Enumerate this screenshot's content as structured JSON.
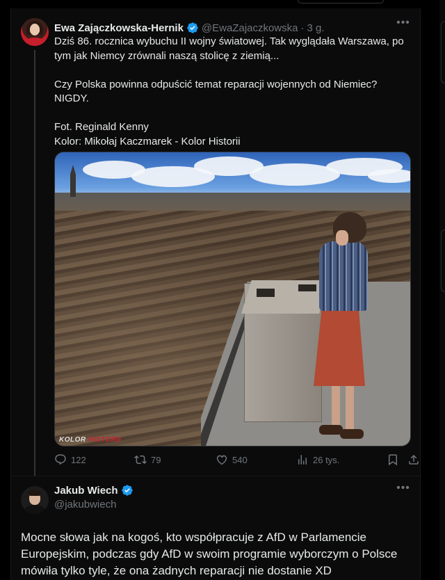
{
  "tweet1": {
    "author_name": "Ewa Zajączkowska-Hernik",
    "author_handle": "@EwaZajaczkowska",
    "separator": "·",
    "time": "3 g.",
    "lines": [
      "Dziś 86. rocznica wybuchu II wojny światowej. Tak wyglądała Warszawa, po tym jak Niemcy zrównali naszą stolicę z ziemią...",
      "",
      "Czy Polska powinna odpuścić temat reparacji wojennych od Niemiec?",
      "NIGDY.",
      "",
      "Fot. Reginald Kenny",
      "Kolor: Mikołaj Kaczmarek - Kolor Historii"
    ],
    "photo_watermark": "KOLOR",
    "photo_watermark_red": "HISTORII",
    "stats": {
      "replies": "122",
      "reposts": "79",
      "likes": "540",
      "views": "26 tys."
    }
  },
  "tweet2": {
    "author_name": "Jakub Wiech",
    "author_handle": "@jakubwiech",
    "text": "Mocne słowa jak na kogoś, kto współpracuje z AfD w Parlamencie Europejskim, podczas gdy AfD w swoim programie wyborczym o Polsce mówiła tylko tyle, że ona żadnych reparacji nie dostanie XD"
  },
  "icons": [
    "more-icon",
    "verified-badge-icon",
    "reply-icon",
    "repost-icon",
    "like-icon",
    "views-icon",
    "bookmark-icon",
    "share-icon"
  ],
  "colors": {
    "background": "#000000",
    "text": "#e7e9ea",
    "muted": "#71767b",
    "verified": "#1d9bf0",
    "border": "#2f3336"
  }
}
